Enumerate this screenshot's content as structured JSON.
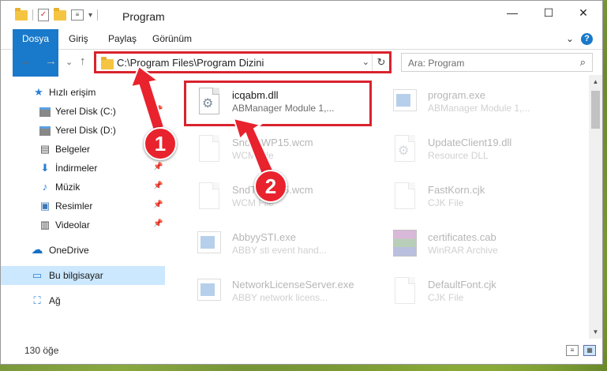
{
  "window": {
    "title": "Program",
    "controls": {
      "minimize": "—",
      "maximize": "☐",
      "close": "✕"
    }
  },
  "ribbon": {
    "tabs": [
      "Dosya",
      "Giriş",
      "Paylaş",
      "Görünüm"
    ],
    "expand_glyph": "⌄",
    "help_glyph": "?"
  },
  "nav": {
    "back": "←",
    "forward": "→",
    "recent": "⌄",
    "up": "↑",
    "address": "C:\\Program Files\\Program Dizini",
    "address_dropdown": "⌄",
    "refresh": "↻",
    "search_placeholder": "Ara: Program",
    "search_icon": "⌕"
  },
  "sidebar": {
    "items": [
      {
        "label": "Hızlı erişim",
        "icon": "star-icon",
        "glyph": "★",
        "color": "#2a7fd4"
      },
      {
        "label": "Yerel Disk (C:)",
        "icon": "drive-icon",
        "glyph": "",
        "pinned": true
      },
      {
        "label": "Yerel Disk (D:)",
        "icon": "drive-icon",
        "glyph": ""
      },
      {
        "label": "Belgeler",
        "icon": "documents-icon",
        "glyph": "▤",
        "pinned": true
      },
      {
        "label": "İndirmeler",
        "icon": "downloads-icon",
        "glyph": "⬇",
        "color": "#2a7fd4",
        "pinned": true
      },
      {
        "label": "Müzik",
        "icon": "music-icon",
        "glyph": "♪",
        "color": "#2a7fd4",
        "pinned": true
      },
      {
        "label": "Resimler",
        "icon": "pictures-icon",
        "glyph": "▣",
        "pinned": true
      },
      {
        "label": "Videolar",
        "icon": "videos-icon",
        "glyph": "▥",
        "pinned": true
      },
      {
        "label": "OneDrive",
        "icon": "cloud-icon",
        "glyph": "☁",
        "color": "#1a6fc4"
      },
      {
        "label": "Bu bilgisayar",
        "icon": "computer-icon",
        "glyph": "🖳",
        "selected": true
      },
      {
        "label": "Ağ",
        "icon": "network-icon",
        "glyph": "⛶",
        "color": "#2a7fd4"
      }
    ],
    "pin_glyph": "📌"
  },
  "files": [
    {
      "name": "icqabm.dll",
      "desc": "ABManager Module 1,...",
      "icon": "dll",
      "highlighted": true
    },
    {
      "name": "program.exe",
      "desc": "ABManager Module 1,...",
      "icon": "app"
    },
    {
      "name": "SndToWP15.wcm",
      "desc": "WCM File",
      "icon": "doc"
    },
    {
      "name": "UpdateClient19.dll",
      "desc": "Resource DLL",
      "icon": "dll"
    },
    {
      "name": "SndToWP15.wcm",
      "desc": "WCM File",
      "icon": "doc"
    },
    {
      "name": "FastKorn.cjk",
      "desc": "CJK File",
      "icon": "doc"
    },
    {
      "name": "AbbyySTI.exe",
      "desc": "ABBY sti event hand...",
      "icon": "app"
    },
    {
      "name": "certificates.cab",
      "desc": "WinRAR Archive",
      "icon": "rar"
    },
    {
      "name": "NetworkLicenseServer.exe",
      "desc": "ABBY network licens...",
      "icon": "app"
    },
    {
      "name": "DefaultFont.cjk",
      "desc": "CJK File",
      "icon": "doc"
    }
  ],
  "status": {
    "count": "130 öğe"
  },
  "annotations": {
    "step1": "1",
    "step2": "2",
    "color": "#e8232e"
  }
}
